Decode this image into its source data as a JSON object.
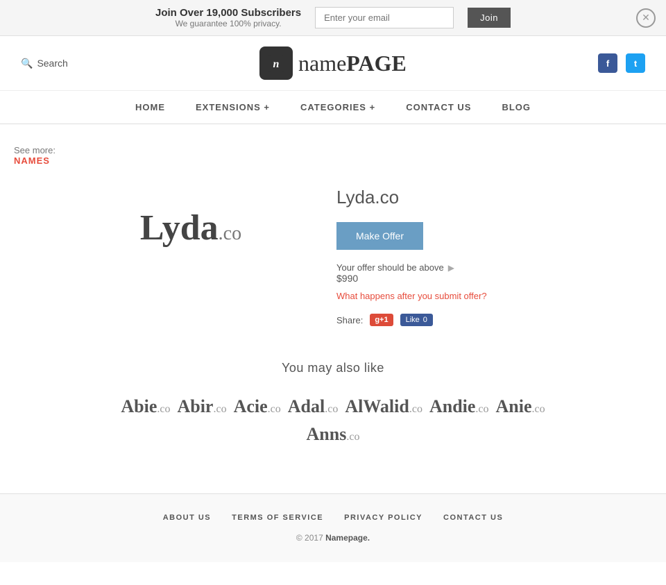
{
  "banner": {
    "title": "Join Over 19,000 Subscribers",
    "subtitle": "We guarantee 100% privacy.",
    "email_placeholder": "Enter your email",
    "join_label": "Join"
  },
  "header": {
    "search_label": "Search",
    "logo_icon": "n",
    "logo_name_part1": "name",
    "logo_name_part2": "PAGE"
  },
  "nav": {
    "items": [
      {
        "label": "HOME",
        "href": "#"
      },
      {
        "label": "EXTENSIONS +",
        "href": "#"
      },
      {
        "label": "CATEGORIES +",
        "href": "#"
      },
      {
        "label": "CONTACT US",
        "href": "#"
      },
      {
        "label": "BLOG",
        "href": "#"
      }
    ]
  },
  "breadcrumb": {
    "see_more": "See more:",
    "link_label": "NAMES"
  },
  "domain": {
    "name": "Lyda",
    "tld": ".co",
    "full": "Lyda.co",
    "make_offer_label": "Make Offer",
    "offer_note": "Your offer should be above",
    "price": "$990",
    "offer_question": "What happens after you submit offer?",
    "share_label": "Share:",
    "gplus_label": "g+1",
    "fb_like_label": "Like",
    "fb_count": "0"
  },
  "also_like": {
    "heading": "You may also like",
    "items": [
      {
        "name": "Abie",
        "tld": ".co"
      },
      {
        "name": "Abir",
        "tld": ".co"
      },
      {
        "name": "Acie",
        "tld": ".co"
      },
      {
        "name": "Adal",
        "tld": ".co"
      },
      {
        "name": "AlWalid",
        "tld": ".co"
      },
      {
        "name": "Andie",
        "tld": ".co"
      },
      {
        "name": "Anie",
        "tld": ".co"
      },
      {
        "name": "Anns",
        "tld": ".co"
      }
    ]
  },
  "footer": {
    "links": [
      {
        "label": "ABOUT US",
        "href": "#"
      },
      {
        "label": "TERMS OF SERVICE",
        "href": "#"
      },
      {
        "label": "PRIVACY POLICY",
        "href": "#"
      },
      {
        "label": "CONTACT US",
        "href": "#"
      }
    ],
    "copyright": "© 2017",
    "brand": "Namepage."
  }
}
